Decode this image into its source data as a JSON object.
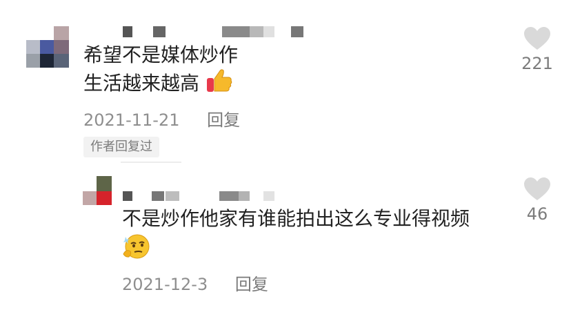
{
  "comments": [
    {
      "text_line1": "希望不是媒体炒作",
      "text_line2": "生活越来越高",
      "emoji_icon": "thumbs-up-emoji",
      "date": "2021-11-21",
      "reply_label": "回复",
      "author_replied_badge": "作者回复过",
      "likes": "221"
    },
    {
      "text_line1": "不是炒作他家有谁能拍出这么专业得视频",
      "emoji_icon": "smirk-thinking-emoji",
      "date": "2021-12-3",
      "reply_label": "回复",
      "likes": "46"
    }
  ],
  "colors": {
    "text": "#222222",
    "meta": "#8e8e8e",
    "heart": "#d9d9d9",
    "badge_bg": "#f2f2f2"
  }
}
